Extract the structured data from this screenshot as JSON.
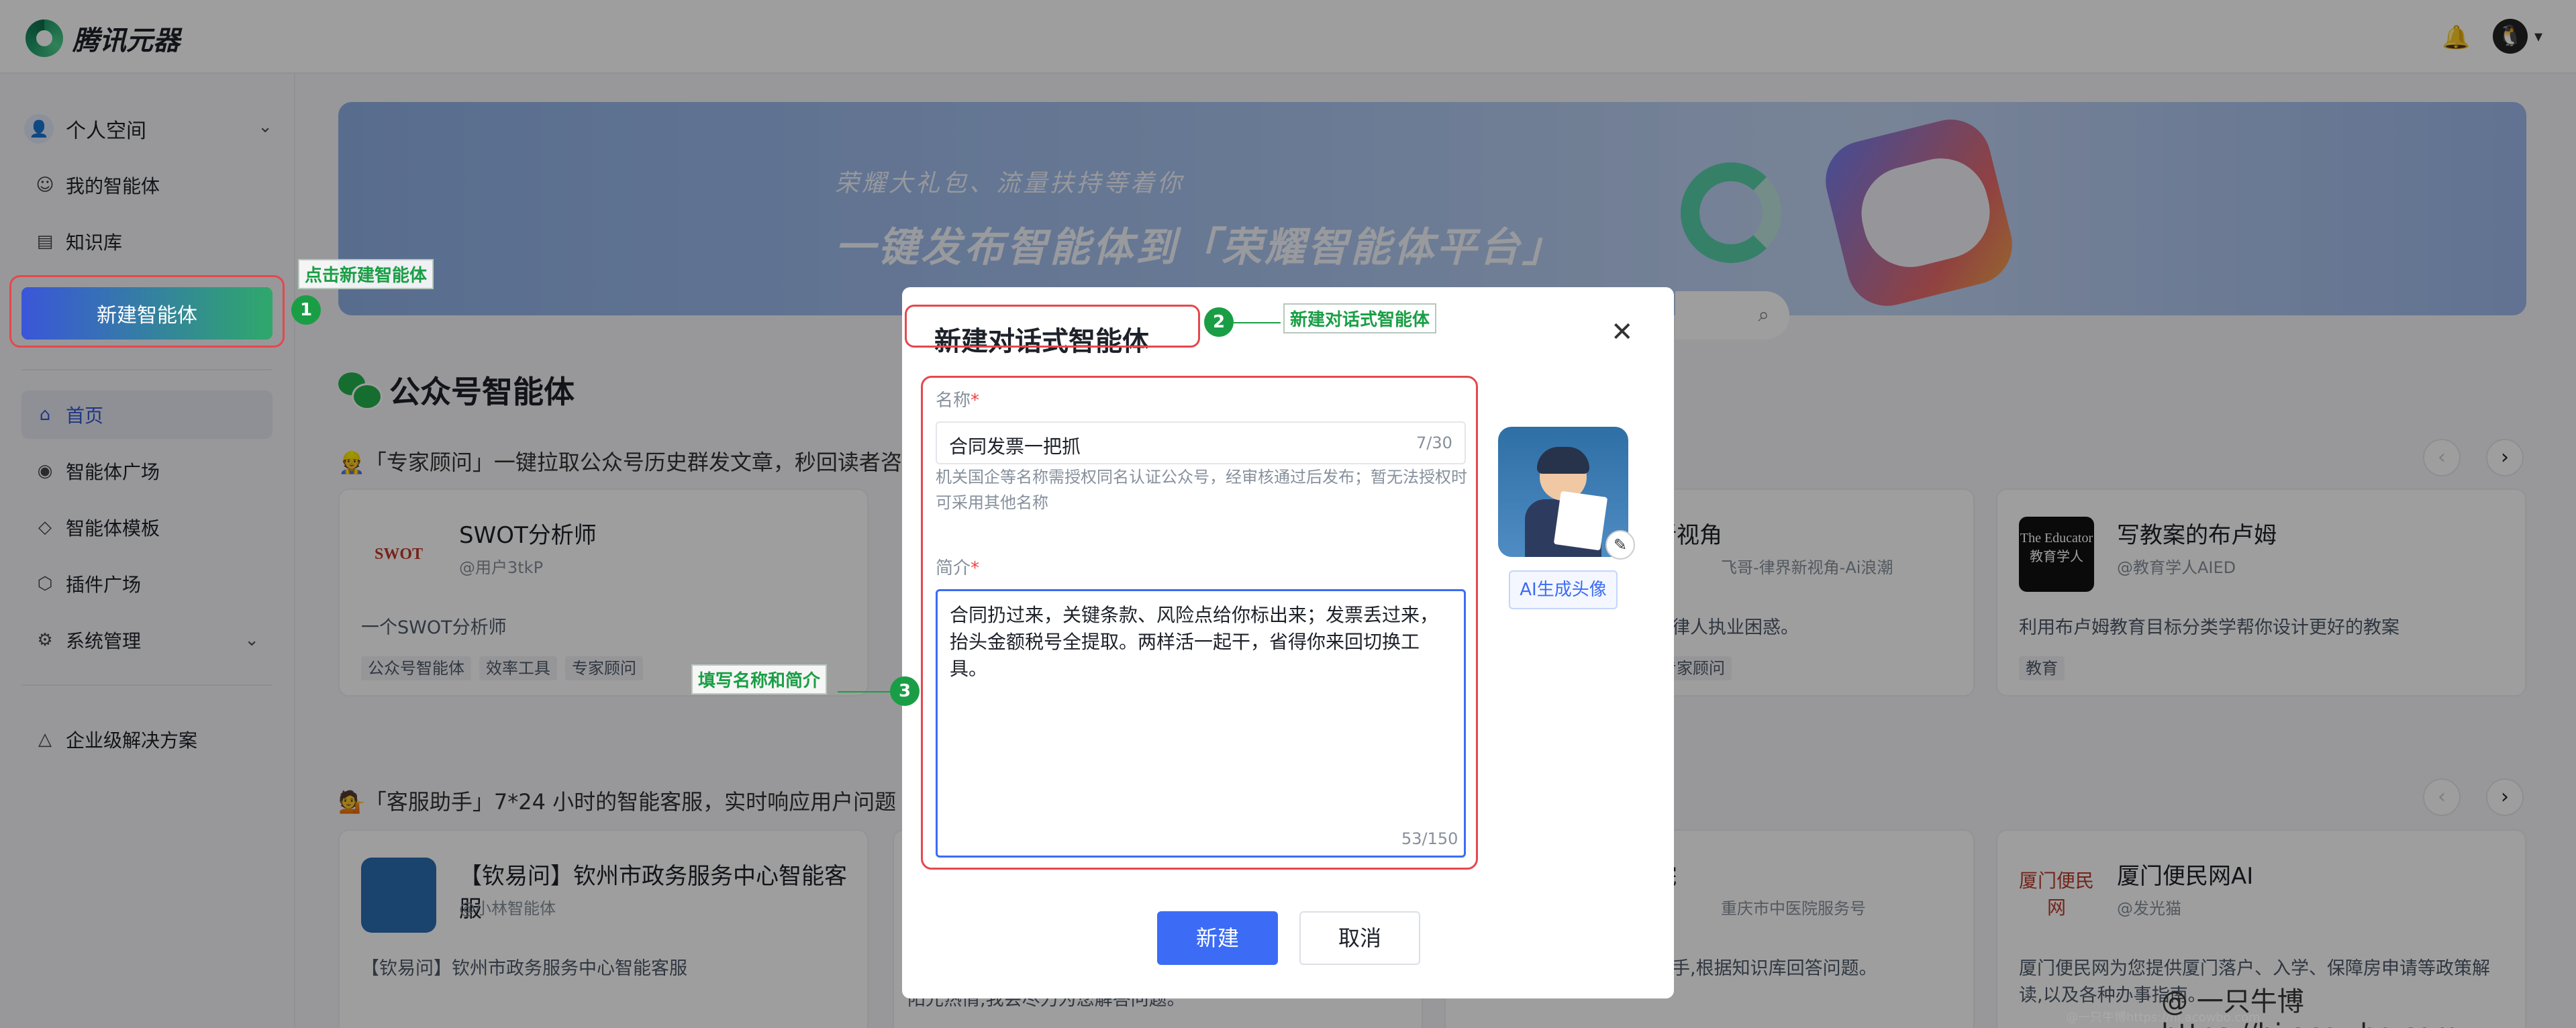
{
  "header": {
    "app_name": "腾讯元器",
    "bell_icon": "bell-icon",
    "avatar_icon": "penguin-icon",
    "avatar_glyph": "🐧",
    "caret": "▾"
  },
  "sidebar": {
    "space_label": "个人空间",
    "items_top": [
      {
        "label": "我的智能体",
        "icon": "agent-icon",
        "glyph": "☺"
      },
      {
        "label": "知识库",
        "icon": "document-icon",
        "glyph": "▤"
      }
    ],
    "new_agent_label": "新建智能体",
    "items_main": [
      {
        "label": "首页",
        "icon": "home-icon",
        "glyph": "⌂"
      },
      {
        "label": "智能体广场",
        "icon": "eye-icon",
        "glyph": "◉"
      },
      {
        "label": "智能体模板",
        "icon": "leaf-icon",
        "glyph": "◇"
      },
      {
        "label": "插件广场",
        "icon": "cube-icon",
        "glyph": "⬡"
      },
      {
        "label": "系统管理",
        "icon": "gear-icon",
        "glyph": "⚙"
      }
    ],
    "enterprise_label": "企业级解决方案",
    "enterprise_glyph": "△"
  },
  "banner": {
    "subtitle": "荣耀大礼包、流量扶持等着你",
    "title": "一键发布智能体到「荣耀智能体平台」"
  },
  "section": {
    "title": "公众号智能体",
    "row1_title": "「专家顾问」一键拉取公众号历史群发文章，秒回读者咨",
    "row2_title": "「客服助手」7*24 小时的智能客服，实时响应用户问题"
  },
  "cards": [
    {
      "name": "SWOT分析师",
      "author": "@用户3tkP",
      "desc": "一个SWOT分析师",
      "logo": "SWOT",
      "tags": [
        "公众号智能体",
        "效率工具",
        "专家顾问"
      ]
    },
    {
      "name": "新视角",
      "author": "飞哥-律界新视角-Ai浪潮",
      "desc": "决律人执业困惑。",
      "tags": [
        "专家顾问"
      ]
    },
    {
      "name": "写教案的布卢姆",
      "author": "@教育学人AIED",
      "desc": "利用布卢姆教育目标分类学帮你设计更好的教案",
      "logo": "The Educator 教育学人",
      "tags": [
        "教育"
      ]
    },
    {
      "name": "【钦易问】钦州市政务服务中心智能客服",
      "author": "@小林智能体",
      "desc": "【钦易问】钦州市政务服务中心智能客服"
    },
    {
      "name": "院",
      "author": "重庆市中医院服务号",
      "desc": "助手,根据知识库回答问题。"
    },
    {
      "name": "厦门便民网AI",
      "author": "@发光猫",
      "desc": "厦门便民网为您提供厦门落户、入学、保障房申请等政策解读,以及各种办事指南。",
      "logo": "厦门便民网"
    }
  ],
  "card_fragment": "阳光热情,我会尽力为您解答问题。",
  "modal": {
    "title": "新建对话式智能体",
    "name_label": "名称",
    "name_value": "合同发票一把抓",
    "name_count": "7/30",
    "name_hint": "机关国企等名称需授权同名认证公众号，经审核通过后发布；暂无法授权时可采用其他名称",
    "desc_label": "简介",
    "desc_value": "合同扔过来，关键条款、风险点给你标出来；发票丢过来，抬头金额税号全提取。两样活一起干，省得你来回切换工具。",
    "desc_count": "53/150",
    "ai_avatar_label": "AI生成头像",
    "create_label": "新建",
    "cancel_label": "取消"
  },
  "annotations": [
    {
      "num": "1",
      "text": "点击新建智能体"
    },
    {
      "num": "2",
      "text": "新建对话式智能体"
    },
    {
      "num": "3",
      "text": "填写名称和简介"
    }
  ],
  "watermark": "@ 一只牛博 https://hi.acowbo.com",
  "watermark_small": "@一只牛博https://hi.acowbo.com",
  "colors": {
    "accent": "#3c6cf5",
    "annotation": "#1a9e45",
    "highlight": "#e5484d"
  }
}
